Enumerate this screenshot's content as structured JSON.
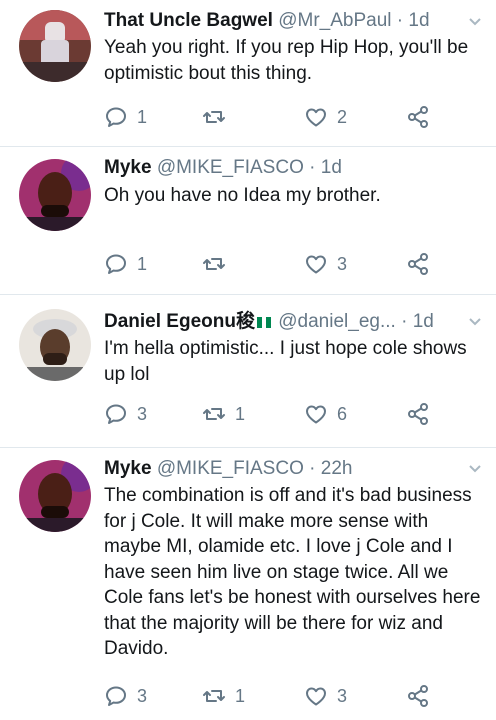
{
  "tweets": [
    {
      "name": "That Uncle Bagwel",
      "handle": "@Mr_AbPaul",
      "time": "1d",
      "text": "Yeah you right. If you rep Hip Hop,  you'll be optimistic bout this thing.",
      "replies": "1",
      "retweets": "",
      "likes": "2",
      "avatar_icon": "avatar-photo-red"
    },
    {
      "name": "Myke",
      "handle": "@MIKE_FIASCO",
      "time": "1d",
      "text": "Oh you have no Idea my brother.",
      "replies": "1",
      "retweets": "",
      "likes": "3",
      "avatar_icon": "avatar-photo-purple"
    },
    {
      "name": "Daniel Egeonu稄",
      "handle": "@daniel_eg...",
      "time": "1d",
      "text": "I'm hella optimistic... I just hope cole shows up lol",
      "replies": "3",
      "retweets": "1",
      "likes": "6",
      "avatar_icon": "avatar-photo-white-cap",
      "flag_colors": [
        "#008751",
        "#ffffff",
        "#008751"
      ]
    },
    {
      "name": "Myke",
      "handle": "@MIKE_FIASCO",
      "time": "22h",
      "text": "The combination is off and it's bad business for j Cole. It will make more sense with maybe MI, olamide etc. I love j Cole and I have seen him live on stage twice. All we Cole fans let's be honest with ourselves here that the majority will be there for wiz and Davido.",
      "replies": "3",
      "retweets": "1",
      "likes": "3",
      "avatar_icon": "avatar-photo-purple"
    }
  ],
  "separator": "·",
  "colors": {
    "text": "#14171a",
    "secondary": "#657786",
    "divider": "#e1e8ed"
  },
  "icons": [
    "reply-icon",
    "retweet-icon",
    "like-icon",
    "share-icon",
    "chevron-down-icon"
  ]
}
